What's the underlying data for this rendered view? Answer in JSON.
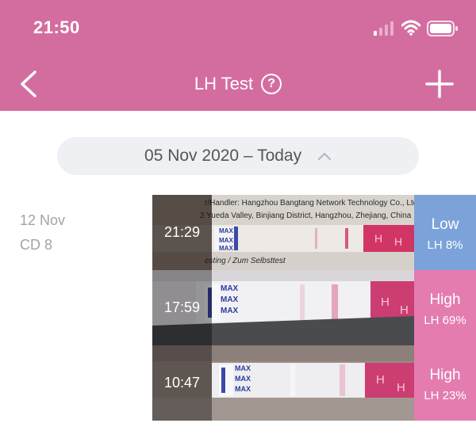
{
  "status_bar": {
    "time": "21:50"
  },
  "nav": {
    "title": "LH Test",
    "help_glyph": "?"
  },
  "date_range": {
    "label": "05 Nov 2020 – Today"
  },
  "day": {
    "date": "12 Nov",
    "cycle_day": "CD 8"
  },
  "strip_text": {
    "row1_header_line1": "r/Handler: Hangzhou Bangtang Network Technology Co., Ltd.",
    "row1_header_line2": "2 Yueda Valley, Binjiang District, Hangzhou, Zhejiang, China",
    "row1_footer": "esting / Zum Selbsttest",
    "max_label": "MAX"
  },
  "tests": [
    {
      "time": "21:29",
      "level": "Low",
      "lh": "LH 8%",
      "color": "#7ba3d9"
    },
    {
      "time": "17:59",
      "level": "High",
      "lh": "LH 69%",
      "color": "#e47cb0"
    },
    {
      "time": "10:47",
      "level": "High",
      "lh": "LH 23%",
      "color": "#e47cb0"
    }
  ],
  "colors": {
    "header": "#d46d9f",
    "pill_background": "#eef0f3",
    "low_result": "#7ba3d9",
    "high_result": "#e47cb0"
  },
  "icons": [
    "signal-icon",
    "wifi-icon",
    "battery-icon",
    "back-arrow-icon",
    "help-icon",
    "add-icon",
    "chevron-up-icon"
  ]
}
